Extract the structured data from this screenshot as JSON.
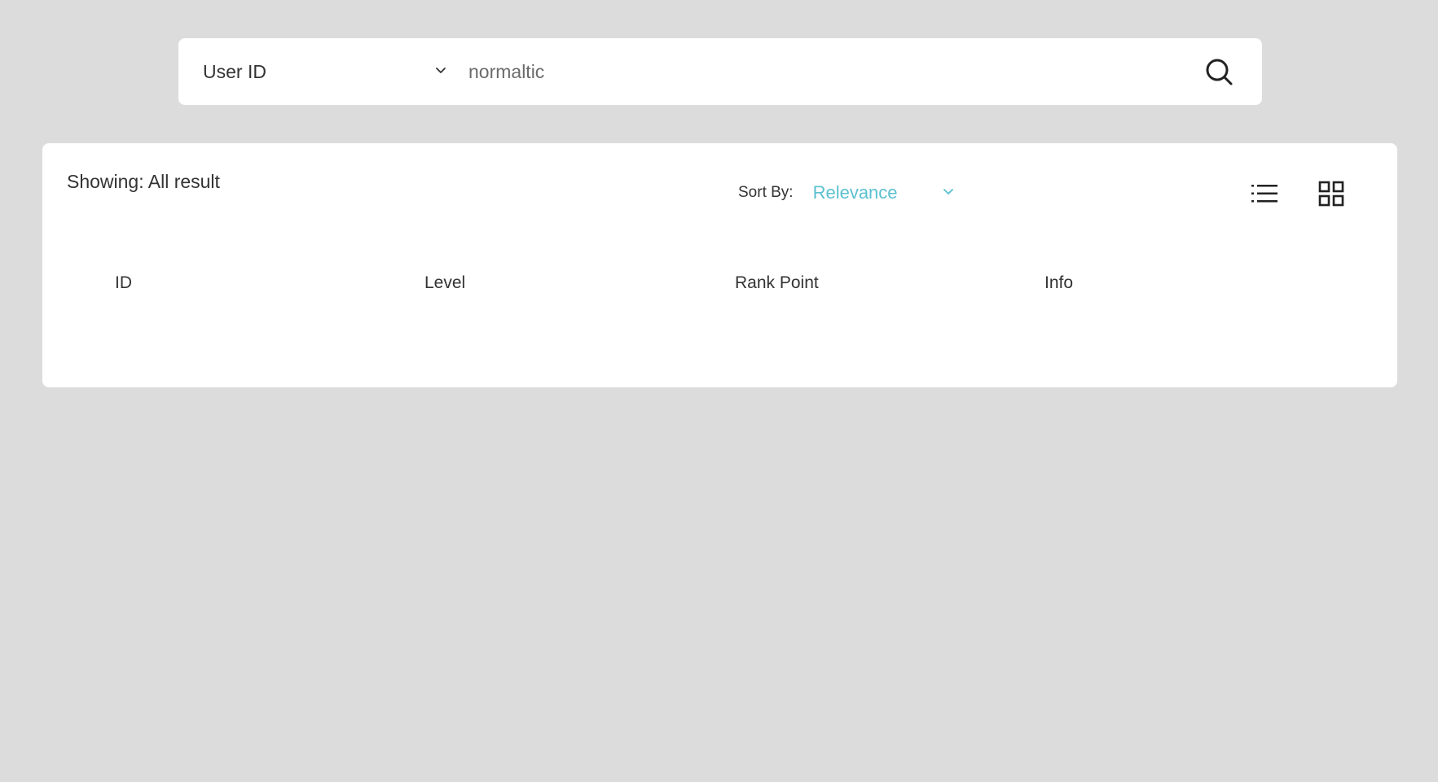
{
  "search": {
    "type_label": "User ID",
    "query_value": "normaltic",
    "icons": {
      "type_dropdown": "chevron-down-icon",
      "submit": "search-icon"
    }
  },
  "results": {
    "showing_label": "Showing: All result",
    "sort": {
      "label": "Sort By:",
      "value": "Relevance",
      "accent_color": "#5bc0cf",
      "icon": "chevron-down-icon"
    },
    "view_toggles": {
      "list_icon": "list-view-icon",
      "grid_icon": "grid-view-icon"
    },
    "table": {
      "columns": [
        "ID",
        "Level",
        "Rank Point",
        "Info"
      ],
      "rows": []
    }
  },
  "colors": {
    "background": "#dcdcdc",
    "card": "#ffffff",
    "text": "#333333",
    "accent": "#5bc0cf"
  }
}
